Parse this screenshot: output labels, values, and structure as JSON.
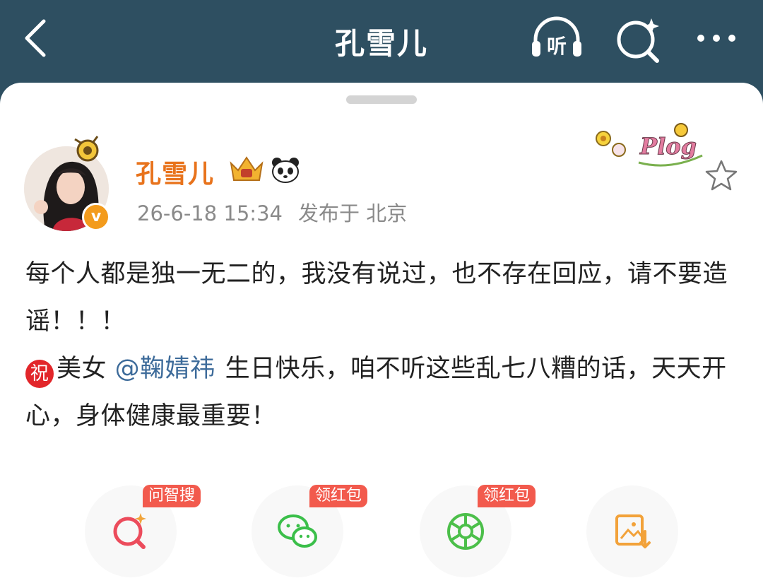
{
  "header": {
    "title": "孔雪儿",
    "listen_label": "听"
  },
  "post": {
    "author_name": "孔雪儿",
    "verified_mark": "v",
    "timestamp": "26-6-18 15:34",
    "location": "发布于 北京",
    "sticker_text": "Plog",
    "line1": "每个人都是独一无二的，我没有说过，也不存在回应，请不要造谣！！！",
    "zhu_char": "祝",
    "line2_prefix": "美女",
    "mention": "@鞠婧祎",
    "line2_suffix": "生日快乐，咱不听这些乱七八糟的话，天天开心，身体健康最重要！"
  },
  "actions": [
    {
      "icon": "ai-search-icon",
      "tag": "问智搜"
    },
    {
      "icon": "wechat-icon",
      "tag": "领红包"
    },
    {
      "icon": "moments-icon",
      "tag": "领红包"
    },
    {
      "icon": "save-image-icon",
      "tag": ""
    }
  ],
  "colors": {
    "header_bg": "#2e4f61",
    "name": "#e8731c",
    "mention": "#3d6b9a",
    "tag": "#f25a4d",
    "verified": "#f39b1c"
  }
}
